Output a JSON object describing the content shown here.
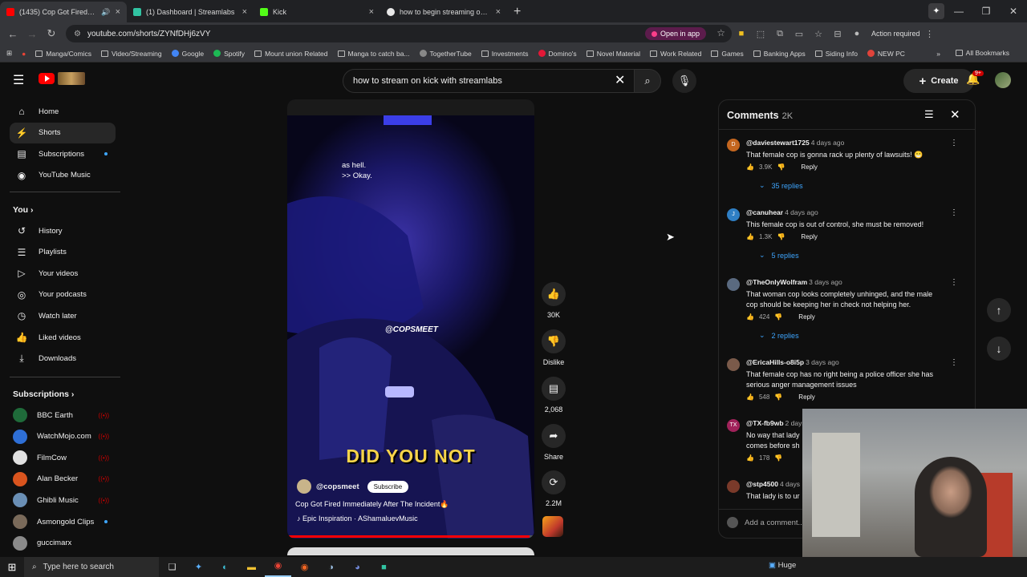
{
  "browser": {
    "tabs": [
      {
        "label": "(1435) Cop Got Fired Imme",
        "color": "#ff0000",
        "active": true,
        "audio": true
      },
      {
        "label": "(1) Dashboard | Streamlabs",
        "color": "#31c3a2",
        "active": false
      },
      {
        "label": "Kick",
        "color": "#53fc18",
        "active": false
      },
      {
        "label": "how to begin streaming on kic",
        "color": "#e8e8e8",
        "active": false
      }
    ],
    "url": "youtube.com/shorts/ZYNfDHj6zVY",
    "open_in_app": "Open in app",
    "action_required": "Action required",
    "bookmarks": [
      {
        "label": "Manga/Comics",
        "type": "folder"
      },
      {
        "label": "Video/Streaming",
        "type": "folder"
      },
      {
        "label": "Google",
        "type": "site",
        "color": "#4285f4"
      },
      {
        "label": "Spotify",
        "type": "site",
        "color": "#1db954"
      },
      {
        "label": "Mount union Related",
        "type": "folder"
      },
      {
        "label": "Manga to catch ba...",
        "type": "folder"
      },
      {
        "label": "TogetherTube",
        "type": "site",
        "color": "#888888"
      },
      {
        "label": "Investments",
        "type": "folder"
      },
      {
        "label": "Domino's",
        "type": "site",
        "color": "#e31837"
      },
      {
        "label": "Novel Material",
        "type": "folder"
      },
      {
        "label": "Work Related",
        "type": "folder"
      },
      {
        "label": "Games",
        "type": "folder"
      },
      {
        "label": "Banking Apps",
        "type": "folder"
      },
      {
        "label": "Siding Info",
        "type": "folder"
      },
      {
        "label": "NEW PC",
        "type": "site",
        "color": "#e0433a"
      }
    ],
    "all_bookmarks": "All Bookmarks"
  },
  "youtube": {
    "search_query": "how to stream on kick with streamlabs",
    "create_label": "Create",
    "notif_count": "9+"
  },
  "sidebar": {
    "main": [
      {
        "label": "Home",
        "icon": "home-icon",
        "glyph": "⌂"
      },
      {
        "label": "Shorts",
        "icon": "shorts-icon",
        "glyph": "⚡",
        "active": true
      },
      {
        "label": "Subscriptions",
        "icon": "subscriptions-icon",
        "glyph": "▤",
        "dot": true
      },
      {
        "label": "YouTube Music",
        "icon": "music-icon",
        "glyph": "◉"
      }
    ],
    "you_header": "You",
    "you": [
      {
        "label": "History",
        "icon": "history-icon",
        "glyph": "↺"
      },
      {
        "label": "Playlists",
        "icon": "playlists-icon",
        "glyph": "☰"
      },
      {
        "label": "Your videos",
        "icon": "your-videos-icon",
        "glyph": "▷"
      },
      {
        "label": "Your podcasts",
        "icon": "podcasts-icon",
        "glyph": "◎"
      },
      {
        "label": "Watch later",
        "icon": "watch-later-icon",
        "glyph": "◷"
      },
      {
        "label": "Liked videos",
        "icon": "liked-icon",
        "glyph": "👍"
      },
      {
        "label": "Downloads",
        "icon": "downloads-icon",
        "glyph": "⤓"
      }
    ],
    "subs_header": "Subscriptions",
    "subs": [
      {
        "label": "BBC Earth",
        "color": "#1f6b3a",
        "live": true
      },
      {
        "label": "WatchMojo.com",
        "color": "#2e6fd6",
        "live": true
      },
      {
        "label": "FilmCow",
        "color": "#e0e0e0",
        "live": true
      },
      {
        "label": "Alan Becker",
        "color": "#d9541e",
        "live": true
      },
      {
        "label": "Ghibli Music",
        "color": "#6a8fb5",
        "live": true
      },
      {
        "label": "Asmongold Clips",
        "color": "#7a6a5a",
        "dot": true
      },
      {
        "label": "guccimarx",
        "color": "#8a8a8a",
        "live": false
      }
    ]
  },
  "video": {
    "caption_line1": "as hell.",
    "caption_line2": ">> Okay.",
    "watermark": "@COPSMEET",
    "overlay_text": "DID YOU NOT",
    "channel": "@copsmeet",
    "subscribe": "Subscribe",
    "title": "Cop Got Fired Immediately After The Incident🔥",
    "music": "Epic Inspiration · AShamaluevMusic",
    "progress": 0.98
  },
  "actions": {
    "likes": "30K",
    "dislike": "Dislike",
    "comments": "2,068",
    "share": "Share",
    "remix": "2.2M"
  },
  "comments": {
    "title": "Comments",
    "count": "2K",
    "items": [
      {
        "author": "@daviestewart1725",
        "time": "4 days ago",
        "text": "That female cop is gonna rack up plenty of lawsuits! 😁",
        "likes": "3.9K",
        "reply": "Reply",
        "replies": "35 replies",
        "avatar_letter": "D",
        "avatar_color": "#c4661f"
      },
      {
        "author": "@canuhear",
        "time": "4 days ago",
        "text": "This female cop is out of control, she must be removed!",
        "likes": "1.3K",
        "reply": "Reply",
        "replies": "5 replies",
        "avatar_letter": "J",
        "avatar_color": "#2f7fc4"
      },
      {
        "author": "@TheOnlyWolfram",
        "time": "3 days ago",
        "text": "That woman cop looks completely unhinged, and the male cop should be keeping her in check not helping her.",
        "likes": "424",
        "reply": "Reply",
        "replies": "2 replies",
        "avatar_letter": "",
        "avatar_color": "#5a6a80"
      },
      {
        "author": "@EricaHills-o8i5p",
        "time": "3 days ago",
        "text": "That female cop has no right being a police officer she has serious anger management issues",
        "likes": "548",
        "reply": "Reply",
        "avatar_letter": "",
        "avatar_color": "#7a5a4a"
      },
      {
        "author": "@TX-fb9wb",
        "time": "2 days",
        "text": "No way that lady",
        "text2": "comes before sh",
        "likes": "178",
        "avatar_letter": "TX",
        "avatar_color": "#a0225a"
      },
      {
        "author": "@stp4500",
        "time": "4 days",
        "text": "That lady is to ur",
        "avatar_letter": "",
        "avatar_color": "#7a3a2a"
      }
    ],
    "add_placeholder": "Add a comment..."
  },
  "taskbar": {
    "search_placeholder": "Type here to search",
    "tray_text": "Huge"
  }
}
